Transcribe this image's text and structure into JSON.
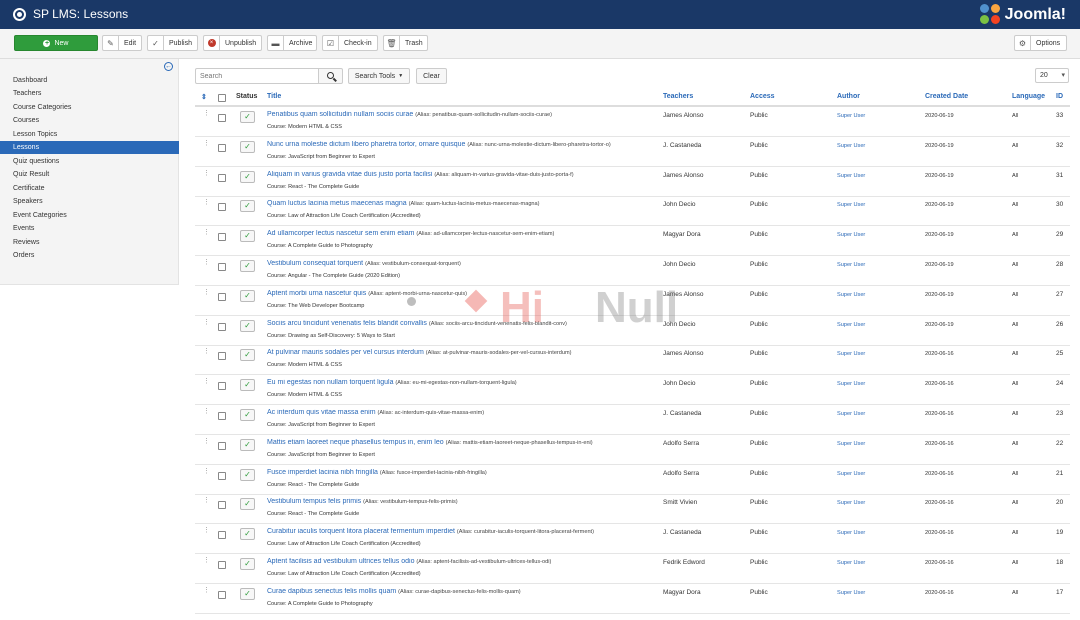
{
  "header": {
    "title": "SP LMS: Lessons",
    "logo_text": "Joomla!"
  },
  "toolbar": {
    "new": "New",
    "edit": "Edit",
    "publish": "Publish",
    "unpublish": "Unpublish",
    "archive": "Archive",
    "checkin": "Check-in",
    "trash": "Trash",
    "options": "Options"
  },
  "sidebar": {
    "items": [
      {
        "label": "Dashboard"
      },
      {
        "label": "Teachers"
      },
      {
        "label": "Course Categories"
      },
      {
        "label": "Courses"
      },
      {
        "label": "Lesson Topics"
      },
      {
        "label": "Lessons"
      },
      {
        "label": "Quiz questions"
      },
      {
        "label": "Quiz Result"
      },
      {
        "label": "Certificate"
      },
      {
        "label": "Speakers"
      },
      {
        "label": "Event Categories"
      },
      {
        "label": "Events"
      },
      {
        "label": "Reviews"
      },
      {
        "label": "Orders"
      }
    ],
    "active": "Lessons"
  },
  "filters": {
    "search_placeholder": "Search",
    "search_tools": "Search Tools",
    "clear": "Clear",
    "limit": "20"
  },
  "table": {
    "headers": {
      "status": "Status",
      "title": "Title",
      "teachers": "Teachers",
      "access": "Access",
      "author": "Author",
      "created_date": "Created Date",
      "language": "Language",
      "id": "ID"
    },
    "rows": [
      {
        "title": "Penatibus quam sollicitudin nullam sociis curae",
        "alias": "(Alias: penatibus-quam-sollicitudin-nullam-sociis-curae)",
        "course": "Course: Modern HTML & CSS",
        "teacher": "James Alonso",
        "access": "Public",
        "author": "Super User",
        "date": "2020-06-19",
        "lang": "All",
        "id": "33"
      },
      {
        "title": "Nunc urna molestie dictum libero pharetra tortor, ornare quisque",
        "alias": "(Alias: nunc-urna-molestie-dictum-libero-pharetra-tortor-o)",
        "course": "Course: JavaScript from Beginner to Expert",
        "teacher": "J. Castaneda",
        "access": "Public",
        "author": "Super User",
        "date": "2020-06-19",
        "lang": "All",
        "id": "32"
      },
      {
        "title": "Aliquam in varius gravida vitae duis justo porta facilisi",
        "alias": "(Alias: aliquam-in-varius-gravida-vitae-duis-justo-porta-f)",
        "course": "Course: React - The Complete Guide",
        "teacher": "James Alonso",
        "access": "Public",
        "author": "Super User",
        "date": "2020-06-19",
        "lang": "All",
        "id": "31"
      },
      {
        "title": "Quam luctus lacinia metus maecenas magna",
        "alias": "(Alias: quam-luctus-lacinia-metus-maecenas-magna)",
        "course": "Course: Law of Attraction Life Coach Certification (Accredited)",
        "teacher": "John Decio",
        "access": "Public",
        "author": "Super User",
        "date": "2020-06-19",
        "lang": "All",
        "id": "30"
      },
      {
        "title": "Ad ullamcorper lectus nascetur sem enim etiam",
        "alias": "(Alias: ad-ullamcorper-lectus-nascetur-sem-enim-etiam)",
        "course": "Course: A Complete Guide to Photography",
        "teacher": "Magyar Dora",
        "access": "Public",
        "author": "Super User",
        "date": "2020-06-19",
        "lang": "All",
        "id": "29"
      },
      {
        "title": "Vestibulum consequat torquent",
        "alias": "(Alias: vestibulum-consequat-torquent)",
        "course": "Course: Angular - The Complete Guide (2020 Edition)",
        "teacher": "John Decio",
        "access": "Public",
        "author": "Super User",
        "date": "2020-06-19",
        "lang": "All",
        "id": "28"
      },
      {
        "title": "Aptent morbi urna nascetur quis",
        "alias": "(Alias: aptent-morbi-urna-nascetur-quis)",
        "course": "Course: The Web Developer Bootcamp",
        "teacher": "James Alonso",
        "access": "Public",
        "author": "Super User",
        "date": "2020-06-19",
        "lang": "All",
        "id": "27"
      },
      {
        "title": "Sociis arcu tincidunt venenatis felis blandit convallis",
        "alias": "(Alias: sociis-arcu-tincidunt-venenatis-felis-blandit-conv)",
        "course": "Course: Drawing as Self-Discovery: 5 Ways to Start",
        "teacher": "John Decio",
        "access": "Public",
        "author": "Super User",
        "date": "2020-06-19",
        "lang": "All",
        "id": "26"
      },
      {
        "title": "At pulvinar mauris sodales per vel cursus interdum",
        "alias": "(Alias: at-pulvinar-mauris-sodales-per-vel-cursus-interdum)",
        "course": "Course: Modern HTML & CSS",
        "teacher": "James Alonso",
        "access": "Public",
        "author": "Super User",
        "date": "2020-06-16",
        "lang": "All",
        "id": "25"
      },
      {
        "title": "Eu mi egestas non nullam torquent ligula",
        "alias": "(Alias: eu-mi-egestas-non-nullam-torquent-ligula)",
        "course": "Course: Modern HTML & CSS",
        "teacher": "John Decio",
        "access": "Public",
        "author": "Super User",
        "date": "2020-06-16",
        "lang": "All",
        "id": "24"
      },
      {
        "title": "Ac interdum quis vitae massa enim",
        "alias": "(Alias: ac-interdum-quis-vitae-massa-enim)",
        "course": "Course: JavaScript from Beginner to Expert",
        "teacher": "J. Castaneda",
        "access": "Public",
        "author": "Super User",
        "date": "2020-06-16",
        "lang": "All",
        "id": "23"
      },
      {
        "title": "Mattis etiam laoreet neque phasellus tempus in, enim leo",
        "alias": "(Alias: mattis-etiam-laoreet-neque-phasellus-tempus-in-eni)",
        "course": "Course: JavaScript from Beginner to Expert",
        "teacher": "Adolfo Serra",
        "access": "Public",
        "author": "Super User",
        "date": "2020-06-16",
        "lang": "All",
        "id": "22"
      },
      {
        "title": "Fusce imperdiet lacinia nibh fringilla",
        "alias": "(Alias: fusce-imperdiet-lacinia-nibh-fringilla)",
        "course": "Course: React - The Complete Guide",
        "teacher": "Adolfo Serra",
        "access": "Public",
        "author": "Super User",
        "date": "2020-06-16",
        "lang": "All",
        "id": "21"
      },
      {
        "title": "Vestibulum tempus felis primis",
        "alias": "(Alias: vestibulum-tempus-felis-primis)",
        "course": "Course: React - The Complete Guide",
        "teacher": "Smitt Vivien",
        "access": "Public",
        "author": "Super User",
        "date": "2020-06-16",
        "lang": "All",
        "id": "20"
      },
      {
        "title": "Curabitur iaculis torquent litora placerat fermentum imperdiet",
        "alias": "(Alias: curabitur-iaculis-torquent-litora-placerat-ferment)",
        "course": "Course: Law of Attraction Life Coach Certification (Accredited)",
        "teacher": "J. Castaneda",
        "access": "Public",
        "author": "Super User",
        "date": "2020-06-16",
        "lang": "All",
        "id": "19"
      },
      {
        "title": "Aptent facilisis ad vestibulum ultrices tellus odio",
        "alias": "(Alias: aptent-facilisis-ad-vestibulum-ultrices-tellus-odi)",
        "course": "Course: Law of Attraction Life Coach Certification (Accredited)",
        "teacher": "Fedrik Edword",
        "access": "Public",
        "author": "Super User",
        "date": "2020-06-16",
        "lang": "All",
        "id": "18"
      },
      {
        "title": "Curae dapibus senectus felis mollis quam",
        "alias": "(Alias: curae-dapibus-senectus-felis-mollis-quam)",
        "course": "Course: A Complete Guide to Photography",
        "teacher": "Magyar Dora",
        "access": "Public",
        "author": "Super User",
        "date": "2020-06-16",
        "lang": "All",
        "id": "17"
      }
    ]
  },
  "watermark": {
    "left": "Hi",
    "right": "Null"
  },
  "colors": {
    "header_bg": "#1a3867",
    "accent": "#2a69b8",
    "publish_green": "#2f9c3c",
    "unpublish_red": "#c0392b"
  }
}
